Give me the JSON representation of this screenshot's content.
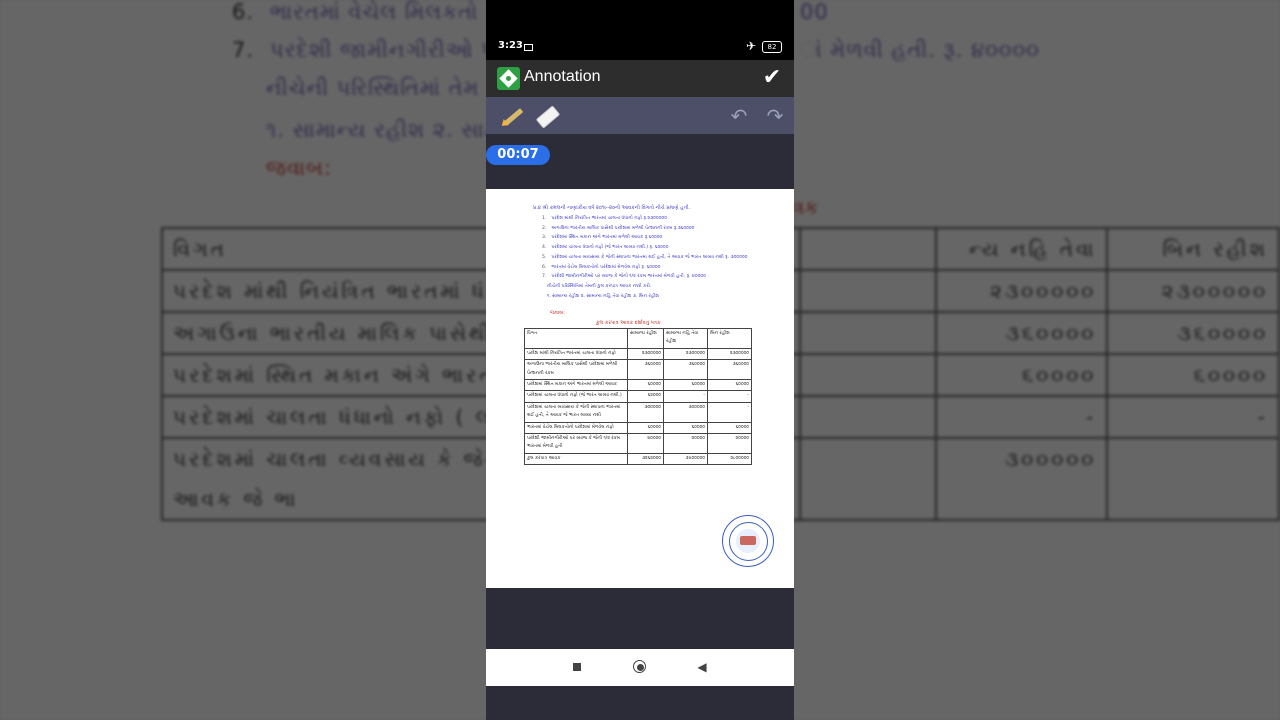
{
  "background_doc": {
    "lines": [
      {
        "num": "6.",
        "text": "ભારતમાં વેચેલ મિલકતો"
      },
      {
        "num": "7.",
        "text": "પરદેશી જામીનગીરીઓ પ"
      },
      {
        "num": "",
        "text": "નીચેની પરિસ્થિતિમાં તેમ"
      },
      {
        "num": "",
        "text": "૧. સામાન્ય રહીશ ૨. સામ"
      }
    ],
    "right_fragments": [
      "00",
      "ાં મેળવી હતી. રૂ. ૪૦૦૦૦"
    ],
    "answer_label": "જવાબ:",
    "stamp": "ત્રક",
    "table": {
      "header": [
        "વિગત",
        "",
        "ન્ય નહિ તેવા",
        "બિન રહીશ"
      ],
      "rows": [
        [
          "પરદેશ માંથી નિયંત્રિત ભારતમાં ધંધાનો નફો",
          "",
          "૨૩૦૦૦૦૦",
          "૨૩૦૦૦૦૦"
        ],
        [
          "અગાઉના ભારતીય માલિક પાસેથી મળેલી પેન્શનની રકમ",
          "",
          "૩૬૦૦૦૦",
          "૩૬૦૦૦૦"
        ],
        [
          "પરદેશમાં સ્થિત મકાન અંગે ભારત આવક",
          "",
          "૬૦૦૦૦",
          "૬૦૦૦૦"
        ],
        [
          "પરદેશમાં ચાલતા ધંધાનો નફો ( લાવ્યા નથી.)",
          "",
          "-",
          "-"
        ],
        [
          "પરદેશમાં ચાલતા વ્યવસાય કે જેની ભારતમાં થઈ હતી, તે આવક જે ભા",
          "",
          "૩૦૦૦૦૦",
          ""
        ]
      ]
    }
  },
  "status_bar": {
    "time": "3:23",
    "battery": "82"
  },
  "app_bar": {
    "title": "Annotation",
    "logo_icon": "annotation-app-logo",
    "confirm_icon": "check-icon"
  },
  "toolbar": {
    "tools": [
      "highlighter-icon",
      "eraser-icon",
      "undo-icon",
      "redo-icon"
    ]
  },
  "timer": "00:07",
  "document": {
    "question": "પ્ર.૪ શ્રી કમલની નાણાંકીય વર્ષ ૨૦૧૯-૨૦ની આવકની વિગતો નીચે પ્રમાણે હતી.",
    "items": [
      {
        "n": "1.",
        "text": "પરદેશ માંથી નિયંત્રિત ભારતમાં ચાલતા ધંધાનો નફો રૂ.૨૩૦૦૦૦૦"
      },
      {
        "n": "2.",
        "text": "અગાઉના ભારતીય માલિક પાસેથી પરદેશમાં મળેલી પેન્શનની રકમ રૂ.૩૬૦૦૦૦"
      },
      {
        "n": "3.",
        "text": "પરદેશમાં સ્થિત મકાન અંગે ભારતમાં મળેલી આવક રૂ.૬૦૦૦૦"
      },
      {
        "n": "4.",
        "text": "પરદેશમાં ચાલતા ધંધાનો નફો (જે ભારત લાવ્યા નથી.) રૂ. ૬૨૦૦૦"
      },
      {
        "n": "5.",
        "text": "પરદેશમાં ચાલતા વ્યવસાય કે જેની સ્થાપના ભારતમાં થઈ હતી, તે આવક જે ભારત લાવ્યા નથી રૂ. ૩૦૦૦૦૦"
      },
      {
        "n": "6.",
        "text": "ભારતમાં વેચેલ મિલકતોનો પરદેશમાં મેળવેલ નફો રૂ. ૬૦૦૦૦"
      },
      {
        "n": "7.",
        "text": "પરદેશી જામીનગીરીઓ પર વ્યાજ કે જેનો ૧/૨ રકમ ભારતમાં મેળવી હતી. રૂ. ૪૦૦૦૦"
      },
      {
        "n": "",
        "text": "નીચેની પરિસ્થિતિમાં તેમની કુલ કરપાત્ર આવક નક્કી કરો."
      },
      {
        "n": "",
        "text": "૧. સામાન્ય રહીશ ૨. સામાન્ય નહિ તેવા રહીશ ૩. બિન રહીશ"
      }
    ],
    "answer_label": "જવાબ:",
    "table_title": "કુલ કરપાત્ર આવક દર્શાવતું પત્રક",
    "table_header": [
      "વિગત",
      "સામાન્ય રહીશ",
      "સામાન્ય નહિ તેવા રહીશ",
      "બિન રહીશ"
    ],
    "table_rows": [
      [
        "પરદેશ માંથી નિયંત્રિત ભારતમાં ચાલતા ધંધાનો નફો",
        "૨૩૦૦૦૦૦",
        "૨૩૦૦૦૦૦",
        "૨૩૦૦૦૦૦"
      ],
      [
        "અગાઉના ભારતીય માલિક પાસેથી પરદેશમાં મળેલી પેન્શનની રકમ",
        "૩૬૦૦૦૦",
        "૩૬૦૦૦૦",
        "૩૬૦૦૦૦"
      ],
      [
        "પરદેશમાં સ્થિત મકાન અંગે ભારતમાં મળેલી આવક",
        "૬૦૦૦૦",
        "૬૦૦૦૦",
        "૬૦૦૦૦"
      ],
      [
        "પરદેશમાં ચાલતા ધંધાનો નફો (જે ભારત લાવ્યા નથી.)",
        "૬૨૦૦૦",
        "-",
        "-"
      ],
      [
        "પરદેશમાં ચાલતા વ્યવસાય કે જેની સ્થાપના ભારતમાં થઈ હતી, તે આવક જે ભારત લાવ્યા નથી",
        "૩૦૦૦૦૦",
        "૩૦૦૦૦૦",
        "-"
      ],
      [
        "ભારતમાં વેચેલ મિલકતોનો પરદેશમાં મેળવેલ નફો",
        "૬૦૦૦૦",
        "૬૦૦૦૦",
        "૬૦૦૦૦"
      ],
      [
        "પરદેશી જામીનગીરીઓ પર વ્યાજ કે જેની ૧/૨ રકમ ભારતમાં મેળવી હતી",
        "૪૦૦૦૦",
        "૨૦૦૦૦",
        "૨૦૦૦૦"
      ],
      [
        "કુલ કરપાત્ર આવક",
        "૩૨૬૨૦૦૦",
        "૩૫૦૦૦૦૦",
        "૨૮૦૦૦૦૦"
      ]
    ],
    "seal": "college-seal-image"
  },
  "nav_bar": {
    "icons": [
      "recents-icon",
      "home-icon",
      "back-icon"
    ]
  }
}
